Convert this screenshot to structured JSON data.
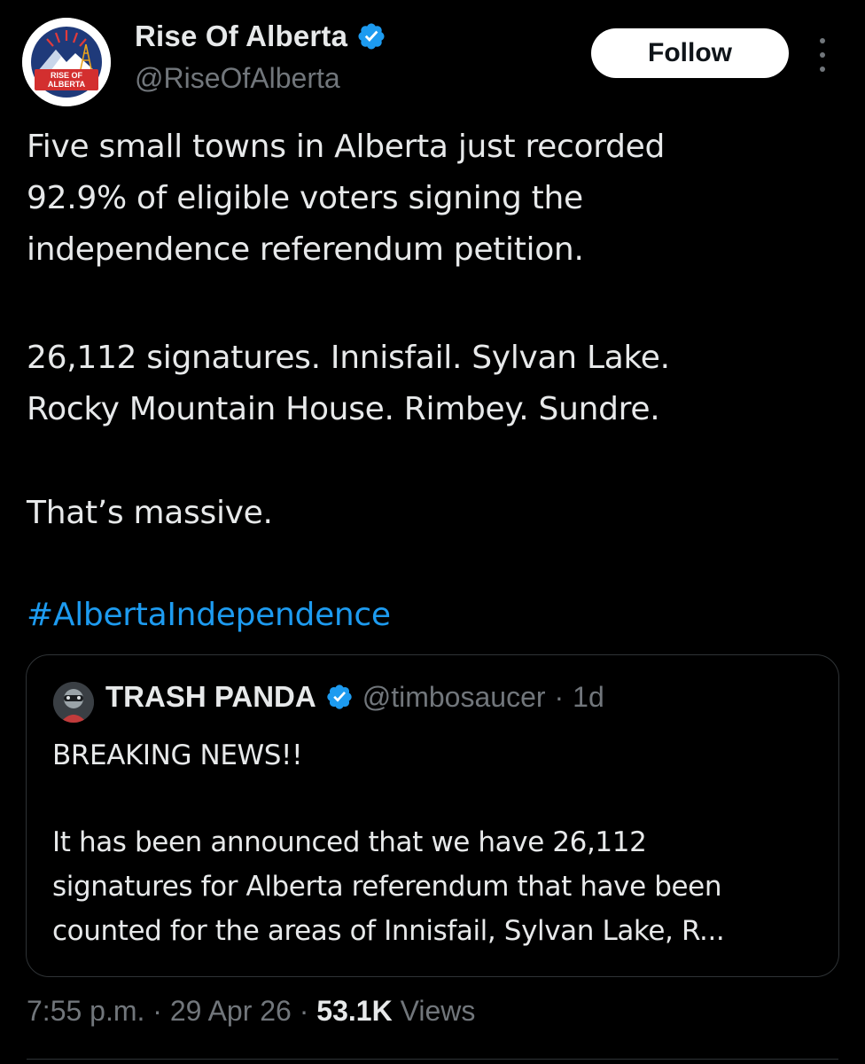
{
  "author": {
    "display_name": "Rise Of Alberta",
    "handle": "@RiseOfAlberta",
    "avatar_text_line1": "RISE OF",
    "avatar_text_line2": "ALBERTA",
    "verified_icon": "verified-badge-icon"
  },
  "actions": {
    "follow_label": "Follow",
    "more_icon": "more-options-icon"
  },
  "tweet": {
    "lines": [
      "Five small towns in Alberta just recorded",
      "92.9% of eligible voters signing the",
      "independence referendum petition.",
      "26,112 signatures. Innisfail. Sylvan Lake.",
      "Rocky Mountain House. Rimbey. Sundre.",
      "That’s massive."
    ],
    "hashtag": "#AlbertaIndependence"
  },
  "quoted_tweet": {
    "display_name": "TRASH PANDA",
    "handle": "@timbosaucer",
    "separator": "·",
    "age": "1d",
    "lines": [
      "BREAKING NEWS!!",
      "It has been announced that we have 26,112",
      "signatures for Alberta referendum that have been",
      "counted for the areas of Innisfail, Sylvan Lake, R..."
    ]
  },
  "meta": {
    "time": "7:55 p.m.",
    "date": "29 Apr 26",
    "separator": "·",
    "views_count": "53.1K",
    "views_label": "Views"
  },
  "colors": {
    "background": "#000000",
    "text": "#e7e9ea",
    "muted": "#71767b",
    "link": "#1d9bf0",
    "verified": "#1d9bf0",
    "border": "#2f3336"
  }
}
